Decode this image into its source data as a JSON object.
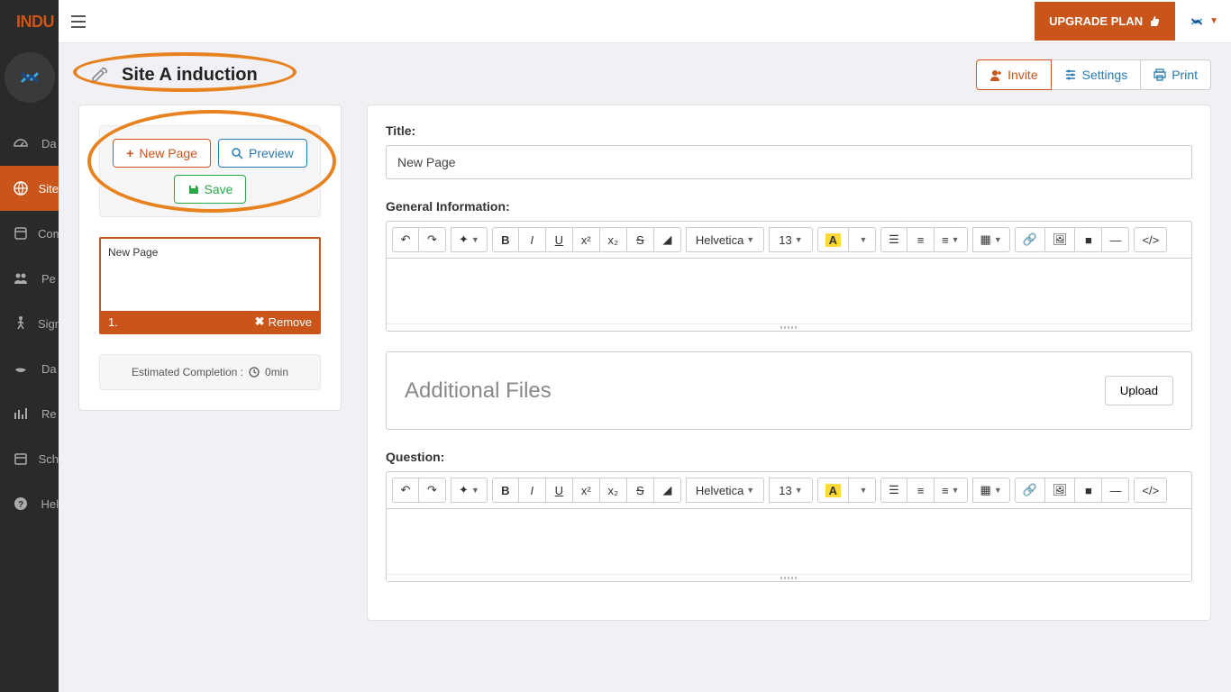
{
  "brand": {
    "logo_text": "INDU"
  },
  "topbar": {
    "upgrade_label": "UPGRADE PLAN"
  },
  "sidebar": {
    "items": [
      {
        "icon": "gauge",
        "label": "Da"
      },
      {
        "icon": "globe",
        "label": "Site"
      },
      {
        "icon": "book",
        "label": "Com"
      },
      {
        "icon": "people",
        "label": "Pe"
      },
      {
        "icon": "walk",
        "label": "Sign"
      },
      {
        "icon": "hand",
        "label": "Da"
      },
      {
        "icon": "chart",
        "label": "Re"
      },
      {
        "icon": "calendar",
        "label": "Sch"
      },
      {
        "icon": "help",
        "label": "Hel"
      }
    ],
    "active_index": 1
  },
  "header": {
    "title": "Site A induction",
    "actions": {
      "invite": "Invite",
      "settings": "Settings",
      "print": "Print"
    }
  },
  "left": {
    "new_page": "New Page",
    "preview": "Preview",
    "save": "Save",
    "pages": [
      {
        "number": "1.",
        "title": "New Page",
        "remove_label": "Remove"
      }
    ],
    "estimated_label": "Estimated Completion :",
    "estimated_value": "0min"
  },
  "editor": {
    "title_label": "Title:",
    "title_value": "New Page",
    "general_label": "General Information:",
    "question_label": "Question:",
    "font_family": "Helvetica",
    "font_size": "13",
    "files_heading": "Additional Files",
    "upload_label": "Upload"
  }
}
